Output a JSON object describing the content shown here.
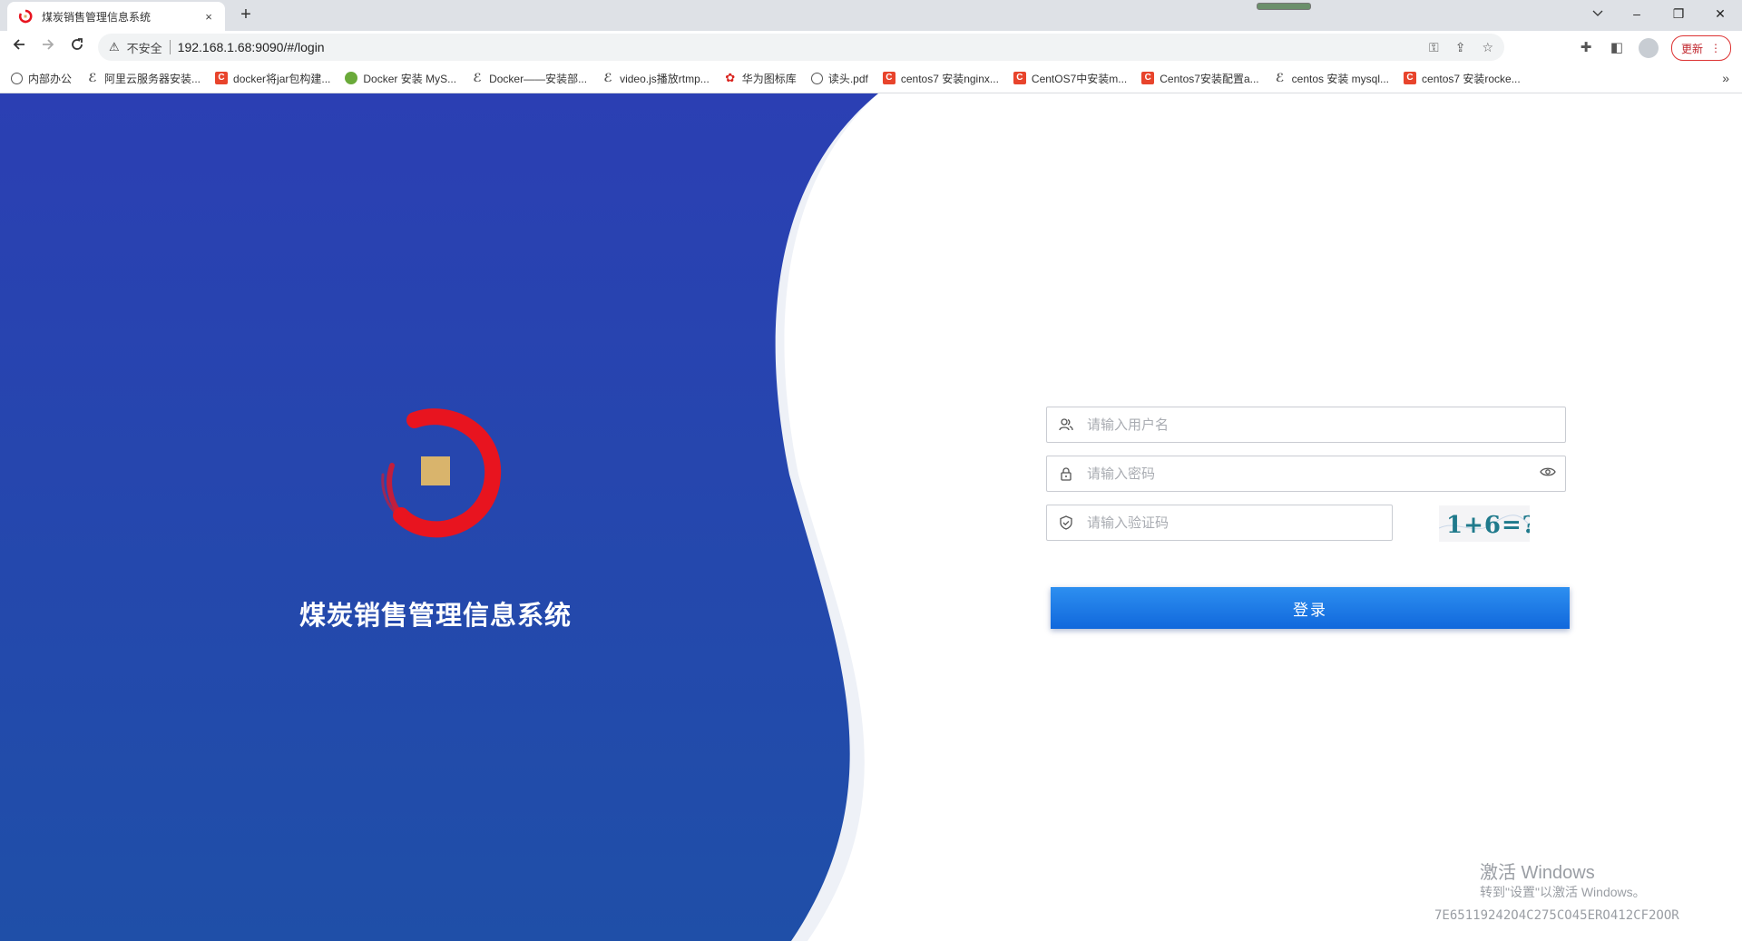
{
  "browser": {
    "tab_title": "煤炭销售管理信息系统",
    "tab_close": "×",
    "new_tab": "+",
    "security_label": "不安全",
    "url": "192.168.1.68:9090/#/login",
    "update_label": "更新",
    "window": {
      "minimize": "–",
      "restore": "❐",
      "close": "✕"
    },
    "bookmarks": [
      {
        "label": "内部办公",
        "icon": "globe-icon",
        "color": "#555555"
      },
      {
        "label": "阿里云服务器安装...",
        "icon": "wave-icon",
        "color": "#555555"
      },
      {
        "label": "docker将jar包构建...",
        "icon": "csdn-icon",
        "color": "#e8442c"
      },
      {
        "label": "Docker 安装 MyS...",
        "icon": "runoob-icon",
        "color": "#6aaa3a"
      },
      {
        "label": "Docker——安装部...",
        "icon": "wave-icon",
        "color": "#555555"
      },
      {
        "label": "video.js播放rtmp...",
        "icon": "wave-icon",
        "color": "#555555"
      },
      {
        "label": "华为图标库",
        "icon": "huawei-icon",
        "color": "#d9231d"
      },
      {
        "label": "读头.pdf",
        "icon": "globe-icon",
        "color": "#555555"
      },
      {
        "label": "centos7 安装nginx...",
        "icon": "csdn-icon",
        "color": "#e8442c"
      },
      {
        "label": "CentOS7中安装m...",
        "icon": "csdn-icon",
        "color": "#e8442c"
      },
      {
        "label": "Centos7安装配置a...",
        "icon": "csdn-icon",
        "color": "#e8442c"
      },
      {
        "label": "centos 安装 mysql...",
        "icon": "wave-icon",
        "color": "#555555"
      },
      {
        "label": "centos7 安装rocke...",
        "icon": "csdn-icon",
        "color": "#e8442c"
      }
    ],
    "bookmarks_more": "»"
  },
  "login": {
    "system_title": "煤炭销售管理信息系统",
    "username_placeholder": "请输入用户名",
    "password_placeholder": "请输入密码",
    "captcha_placeholder": "请输入验证码",
    "captcha_text": "1+6=?",
    "login_label": "登录"
  },
  "watermark": {
    "line1": "激活 Windows",
    "line2": "转到\"设置\"以激活 Windows。",
    "line3": "7E65119242O4C275CO45ERO412CF2OOR"
  },
  "colors": {
    "panel_blue_top": "#2b3fb3",
    "panel_blue_bottom": "#1f4fa8",
    "logo_red": "#e8141f",
    "logo_gold": "#d9b46c",
    "button_blue": "#1168dc"
  }
}
